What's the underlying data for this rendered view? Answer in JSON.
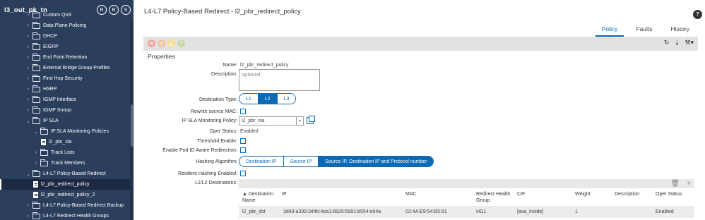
{
  "sidebar": {
    "title": "l3_out_pk_tn",
    "header_icons": [
      "R",
      "B",
      "S"
    ],
    "items": [
      {
        "label": "Custom QoS",
        "type": "folder",
        "expanded": false,
        "indent": 0
      },
      {
        "label": "Data Plane Policing",
        "type": "folder",
        "expanded": false,
        "indent": 0
      },
      {
        "label": "DHCP",
        "type": "folder",
        "expanded": false,
        "indent": 0
      },
      {
        "label": "EIGRP",
        "type": "folder",
        "expanded": false,
        "indent": 0
      },
      {
        "label": "End Point Retention",
        "type": "folder",
        "expanded": false,
        "indent": 0
      },
      {
        "label": "External Bridge Group Profiles",
        "type": "folder",
        "expanded": false,
        "indent": 0
      },
      {
        "label": "First Hop Security",
        "type": "folder",
        "expanded": false,
        "indent": 0
      },
      {
        "label": "HSRP",
        "type": "folder",
        "expanded": false,
        "indent": 0
      },
      {
        "label": "IGMP Interface",
        "type": "folder",
        "expanded": false,
        "indent": 0
      },
      {
        "label": "IGMP Snoop",
        "type": "folder",
        "expanded": false,
        "indent": 0
      },
      {
        "label": "IP SLA",
        "type": "folder",
        "expanded": true,
        "indent": 0
      },
      {
        "label": "IP SLA Monitoring Policies",
        "type": "folder",
        "expanded": true,
        "indent": 1
      },
      {
        "label": "l2_pbr_sla",
        "type": "doc",
        "expanded": false,
        "indent": 2
      },
      {
        "label": "Track Lists",
        "type": "folder",
        "expanded": false,
        "indent": 1
      },
      {
        "label": "Track Members",
        "type": "folder",
        "expanded": false,
        "indent": 1
      },
      {
        "label": "L4-L7 Policy-Based Redirect",
        "type": "folder",
        "expanded": true,
        "indent": 0
      },
      {
        "label": "l2_pbr_redirect_policy",
        "type": "doc",
        "expanded": false,
        "indent": 1,
        "selected": true
      },
      {
        "label": "l2_pbr_redirect_policy_2",
        "type": "doc",
        "expanded": false,
        "indent": 1
      },
      {
        "label": "L4-L7 Policy-Based Redirect Backup",
        "type": "folder",
        "expanded": false,
        "indent": 0
      },
      {
        "label": "L4-L7 Redirect Health Groups",
        "type": "folder",
        "expanded": false,
        "indent": 0
      }
    ]
  },
  "main": {
    "title": "L4-L7 Policy-Based Redirect - l2_pbr_redirect_policy",
    "tabs": [
      {
        "label": "Policy",
        "active": true
      },
      {
        "label": "Faults",
        "active": false
      },
      {
        "label": "History",
        "active": false
      }
    ],
    "fault_icons": [
      {
        "glyph": "✕",
        "color": "#f0a8a0"
      },
      {
        "glyph": "▽",
        "color": "#f5c29a"
      },
      {
        "glyph": "△",
        "color": "#f5dd96"
      },
      {
        "glyph": "!",
        "color": "#c7d9a8"
      }
    ],
    "section_title": "Properties",
    "form": {
      "name_label": "Name:",
      "name_value": "l2_pbr_redirect_policy",
      "description_label": "Description:",
      "description_placeholder": "optional",
      "destination_type_label": "Destination Type:",
      "destination_type_options": [
        "L1",
        "L2",
        "L3"
      ],
      "destination_type_selected": "L2",
      "rewrite_mac_label": "Rewrite source MAC:",
      "ip_sla_label": "IP SLA Monitoring Policy:",
      "ip_sla_value": "l2_pbr_sla",
      "oper_status_label": "Oper Status:",
      "oper_status_value": "Enabled",
      "threshold_label": "Threshold Enable:",
      "pod_id_label": "Enable Pod ID Aware Redirection:",
      "hashing_label": "Hashing Algorithm:",
      "hashing_options": [
        "Destination IP",
        "Source IP",
        "Source IP, Destination IP and Protocol number"
      ],
      "hashing_selected": "Source IP, Destination IP and Protocol number",
      "resilient_label": "Resilient Hashing Enabled:",
      "l1l2_label": "L1/L2 Destinations:"
    },
    "table": {
      "columns": [
        "▲ Destination Name",
        "IP",
        "MAC",
        "Redirect Health Group",
        "CIF",
        "Weight",
        "Description",
        "Oper Status"
      ],
      "rows": [
        [
          "l2_pbr_dst",
          "3d49:a399:3d4b:4ea1:8829:5991:b554:e94a",
          "02:4A:E9:54:B5:91",
          "HG1",
          "[asa_inside]",
          "1",
          "",
          "Enabled"
        ]
      ]
    }
  },
  "colors": {
    "sidebar_bg": "#2b3e5c",
    "accent": "#0a6ab5"
  }
}
